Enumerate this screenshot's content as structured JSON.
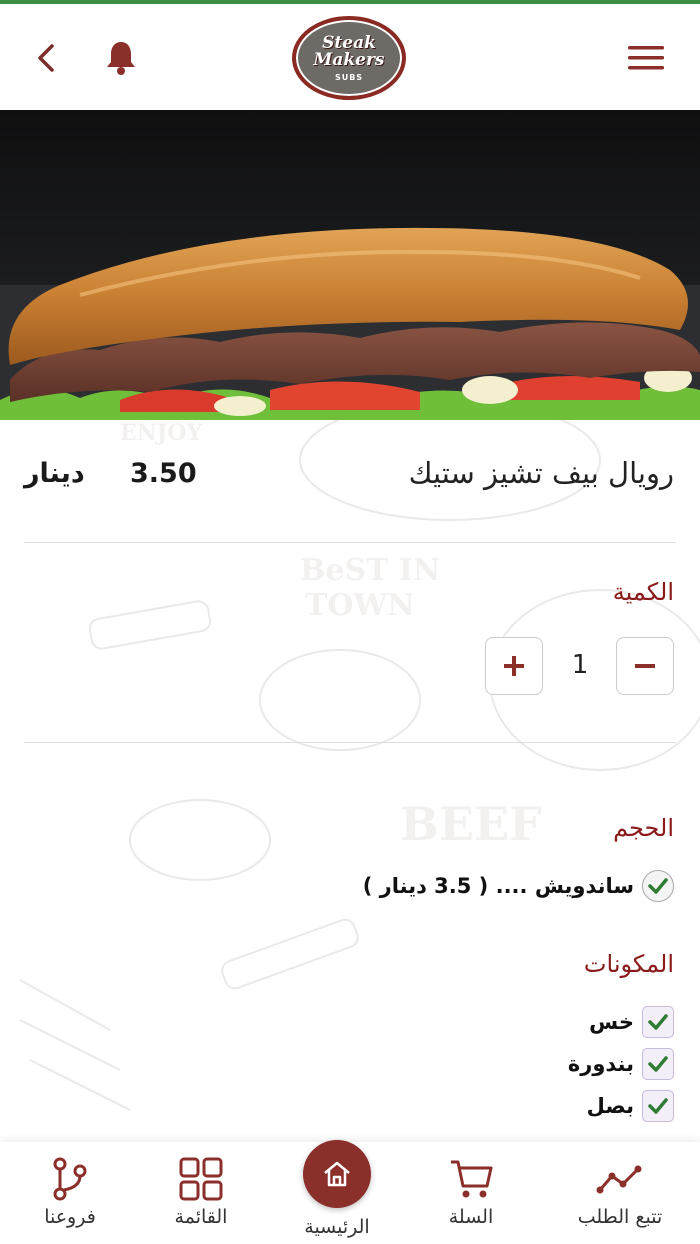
{
  "header": {
    "logo": {
      "line1": "Steak",
      "line2": "Makers",
      "line3": "SUBS"
    }
  },
  "product": {
    "title": "رويال بيف تشيز ستيك",
    "price": "3.50",
    "currency": "دينار"
  },
  "quantity": {
    "label": "الكمية",
    "value": "1"
  },
  "size": {
    "label": "الحجم",
    "options": [
      {
        "text": "ساندويش .... ( 3.5 دينار )",
        "selected": true
      }
    ]
  },
  "ingredients": {
    "label": "المكونات",
    "items": [
      {
        "text": "خس",
        "checked": true
      },
      {
        "text": "بندورة",
        "checked": true
      },
      {
        "text": "بصل",
        "checked": true
      }
    ]
  },
  "bottom_nav": {
    "items": [
      {
        "label": "فروعنا",
        "icon": "branches-icon"
      },
      {
        "label": "القائمة",
        "icon": "grid-icon"
      },
      {
        "label": "الرئيسية",
        "icon": "home-icon"
      },
      {
        "label": "السلة",
        "icon": "cart-icon"
      },
      {
        "label": "تتبع الطلب",
        "icon": "track-order-icon"
      }
    ]
  },
  "colors": {
    "brand": "#8b2f2a",
    "accent_text": "#8b1a1a",
    "check_green": "#2e7d32"
  }
}
